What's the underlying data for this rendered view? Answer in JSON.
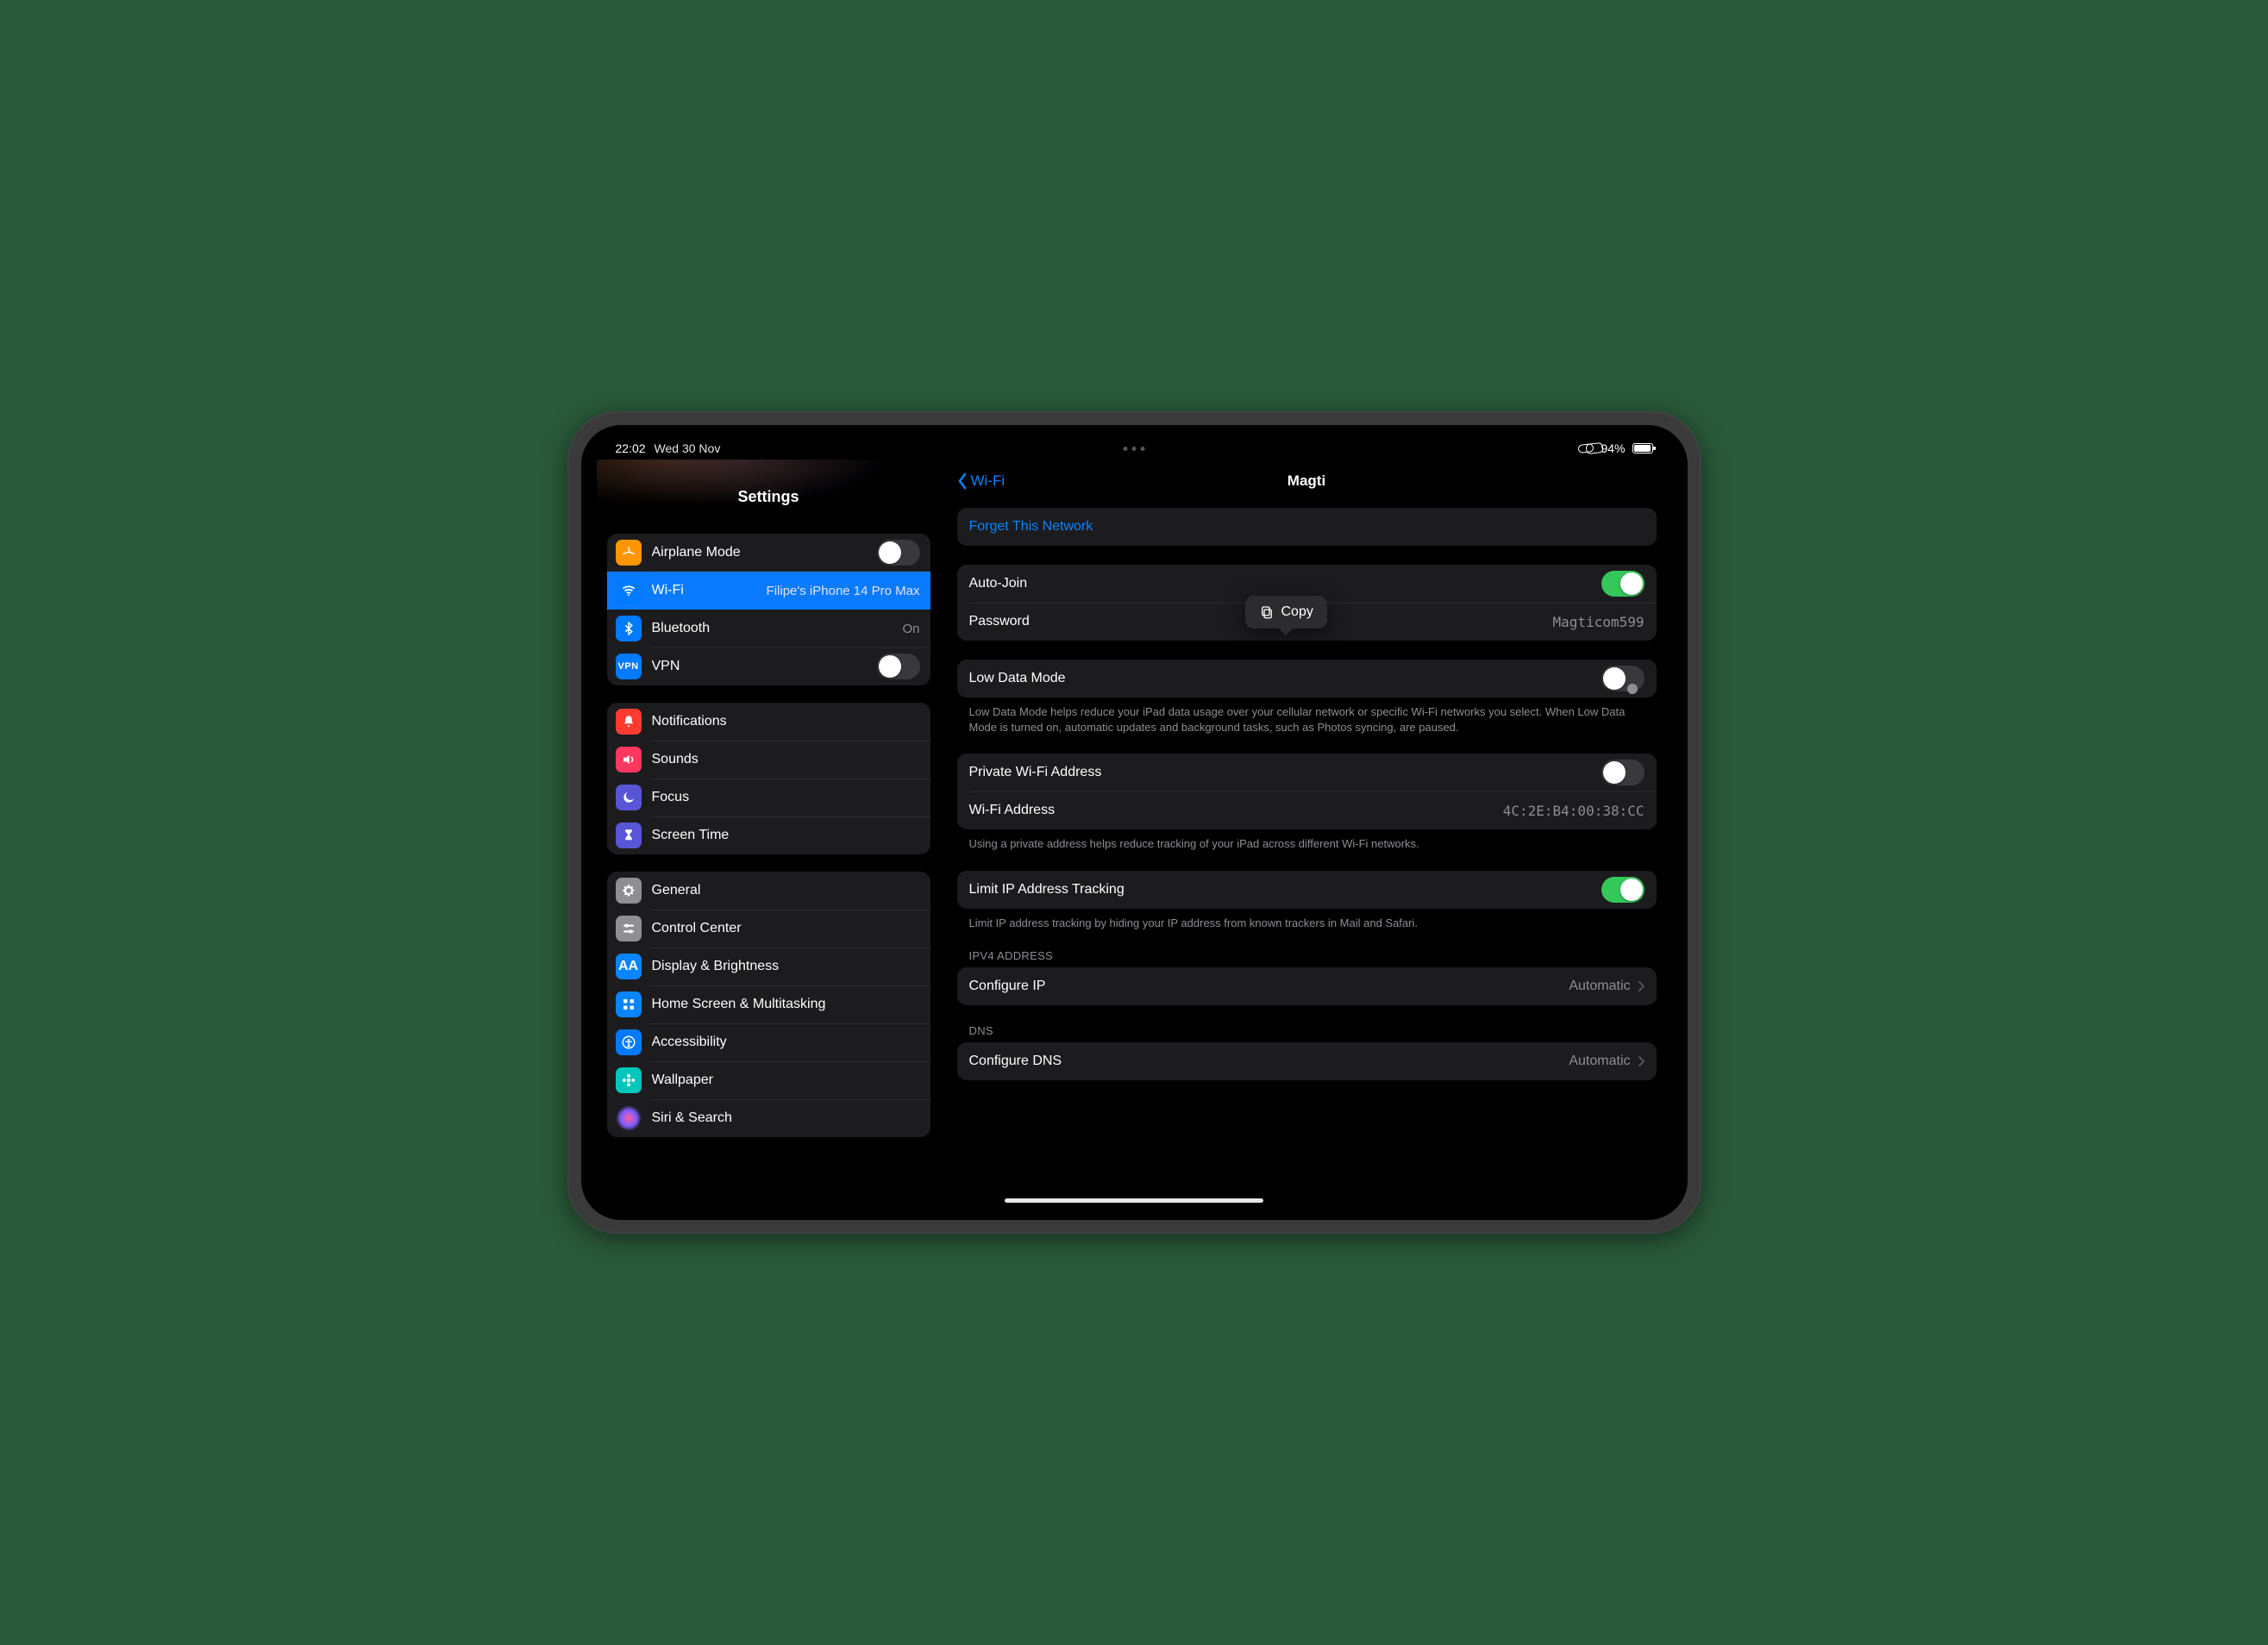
{
  "status": {
    "time": "22:02",
    "date": "Wed 30 Nov",
    "battery_pct": "94%"
  },
  "sidebar": {
    "title": "Settings",
    "group1": {
      "airplane": {
        "label": "Airplane Mode",
        "on": false
      },
      "wifi": {
        "label": "Wi-Fi",
        "value": "Filipe's iPhone 14 Pro Max"
      },
      "bluetooth": {
        "label": "Bluetooth",
        "value": "On"
      },
      "vpn": {
        "label": "VPN",
        "on": false
      }
    },
    "group2": {
      "notifications": "Notifications",
      "sounds": "Sounds",
      "focus": "Focus",
      "screentime": "Screen Time"
    },
    "group3": {
      "general": "General",
      "control_center": "Control Center",
      "display": "Display & Brightness",
      "home": "Home Screen & Multitasking",
      "accessibility": "Accessibility",
      "wallpaper": "Wallpaper",
      "siri": "Siri & Search"
    }
  },
  "detail": {
    "back": "Wi-Fi",
    "title": "Magti",
    "forget": "Forget This Network",
    "autojoin": {
      "label": "Auto-Join",
      "on": true
    },
    "password": {
      "label": "Password",
      "value": "Magticom599"
    },
    "lowdata": {
      "label": "Low Data Mode",
      "on": false,
      "footer": "Low Data Mode helps reduce your iPad data usage over your cellular network or specific Wi-Fi networks you select. When Low Data Mode is turned on, automatic updates and background tasks, such as Photos syncing, are paused."
    },
    "private": {
      "label": "Private Wi-Fi Address",
      "on": false
    },
    "wifi_addr": {
      "label": "Wi-Fi Address",
      "value": "4C:2E:B4:00:38:CC"
    },
    "private_footer": "Using a private address helps reduce tracking of your iPad across different Wi-Fi networks.",
    "limitip": {
      "label": "Limit IP Address Tracking",
      "on": true,
      "footer": "Limit IP address tracking by hiding your IP address from known trackers in Mail and Safari."
    },
    "ipv4_header": "IPV4 ADDRESS",
    "configure_ip": {
      "label": "Configure IP",
      "value": "Automatic"
    },
    "dns_header": "DNS",
    "configure_dns": {
      "label": "Configure DNS",
      "value": "Automatic"
    }
  },
  "popover": {
    "label": "Copy"
  }
}
